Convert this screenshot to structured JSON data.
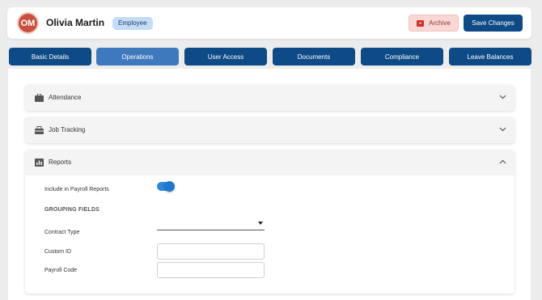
{
  "header": {
    "avatar_initials": "OM",
    "user_name": "Olivia Martin",
    "role_badge": "Employee",
    "archive_label": "Archive",
    "save_label": "Save Changes"
  },
  "tabs": [
    {
      "label": "Basic Details",
      "active": false
    },
    {
      "label": "Operations",
      "active": true
    },
    {
      "label": "User Access",
      "active": false
    },
    {
      "label": "Documents",
      "active": false
    },
    {
      "label": "Compliance",
      "active": false
    },
    {
      "label": "Leave Balances",
      "active": false
    }
  ],
  "sections": [
    {
      "title": "Attendance",
      "icon": "briefcase-icon",
      "expanded": false
    },
    {
      "title": "Job Tracking",
      "icon": "toolbox-icon",
      "expanded": false
    },
    {
      "title": "Reports",
      "icon": "bar-chart-icon",
      "expanded": true
    }
  ],
  "reports": {
    "include_label": "Include in Payroll Reports",
    "include_enabled": true,
    "grouping_title": "GROUPING FIELDS",
    "contract_type_label": "Contract Type",
    "contract_type_value": "",
    "custom_id_label": "Custom ID",
    "custom_id_value": "",
    "payroll_code_label": "Payroll Code",
    "payroll_code_value": ""
  },
  "colors": {
    "primary": "#0d4a86",
    "tab_active": "#3f79bd",
    "avatar": "#c8503e",
    "toggle": "#2f86d6",
    "archive_bg": "#f8d7d4"
  }
}
